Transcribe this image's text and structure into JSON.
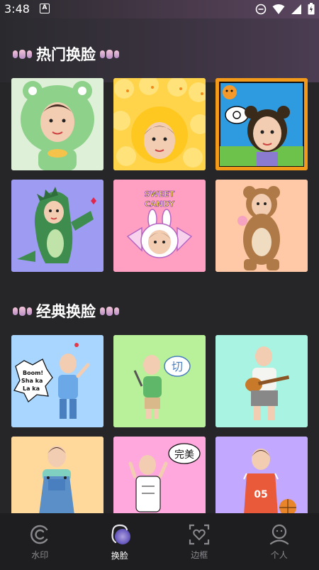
{
  "status": {
    "time": "3:48"
  },
  "sections": [
    {
      "title": "热门换脸"
    },
    {
      "title": "经典换脸"
    }
  ],
  "hot_cards": [
    {
      "bg": "#cfe8c8",
      "theme": "frog-hood"
    },
    {
      "bg": "#ffd34a",
      "theme": "duck-hood"
    },
    {
      "bg": "#f49a1a",
      "theme": "bear-comic"
    },
    {
      "bg": "#9e9cf2",
      "theme": "dinosaur-costume"
    },
    {
      "bg": "#ff9fc1",
      "theme": "candy-bunny",
      "text": "SWEET CANDY"
    },
    {
      "bg": "#ffc8a6",
      "theme": "bear-costume"
    }
  ],
  "classic_cards": [
    {
      "bg": "#a9d6ff",
      "theme": "boom-shakalaka",
      "text": "Boom! Sha ka La ka"
    },
    {
      "bg": "#b9f09a",
      "theme": "cut-sticker",
      "text": "切"
    },
    {
      "bg": "#a9f3e2",
      "theme": "guitar"
    },
    {
      "bg": "#ffd89c",
      "theme": "overalls"
    },
    {
      "bg": "#ffa8de",
      "theme": "perfect",
      "text": "完美"
    },
    {
      "bg": "#c2a9ff",
      "theme": "basketball-jersey",
      "text": "05"
    }
  ],
  "nav": [
    {
      "label": "水印",
      "icon": "watermark-icon",
      "active": false
    },
    {
      "label": "换脸",
      "icon": "face-swap-icon",
      "active": true
    },
    {
      "label": "边框",
      "icon": "frame-heart-icon",
      "active": false
    },
    {
      "label": "个人",
      "icon": "profile-icon",
      "active": false
    }
  ]
}
